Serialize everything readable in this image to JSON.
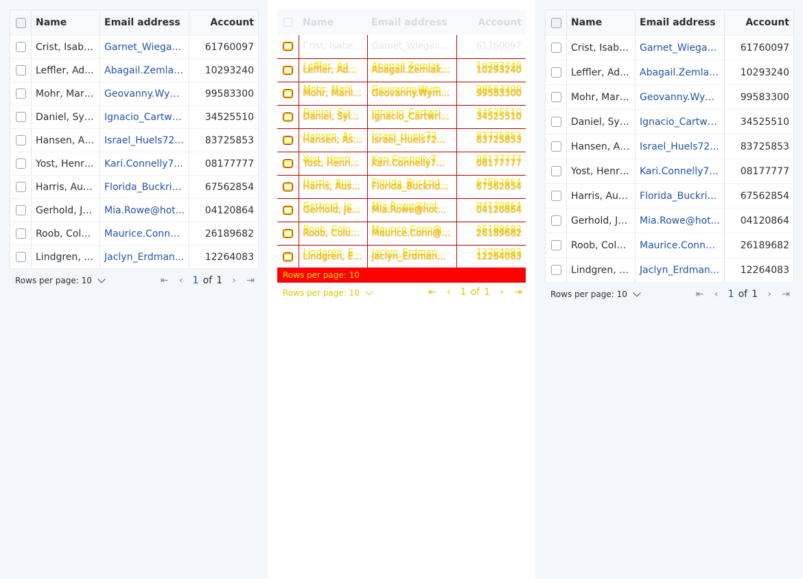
{
  "grid": {
    "columns": [
      "Name",
      "Email address",
      "Account"
    ],
    "rows": [
      {
        "name": "Crist, Isabe...",
        "email": "Garnet_Wiegan...",
        "account": "61760097"
      },
      {
        "name": "Leffler, Ad...",
        "email": "Abagail.Zemlak...",
        "account": "10293240"
      },
      {
        "name": "Mohr, Maril...",
        "email": "Geovanny.Wym...",
        "account": "99583300"
      },
      {
        "name": "Daniel, Syl...",
        "email": "Ignacio_Cartwri...",
        "account": "34525510"
      },
      {
        "name": "Hansen, As...",
        "email": "Israel_Huels72...",
        "account": "83725853"
      },
      {
        "name": "Yost, Henri...",
        "email": "Kari.Connelly7...",
        "account": "08177777"
      },
      {
        "name": "Harris, Aus...",
        "email": "Florida_Buckrid...",
        "account": "67562854"
      },
      {
        "name": "Gerhold, Je...",
        "email": "Mia.Rowe@hot...",
        "account": "04120864"
      },
      {
        "name": "Roob, Colu...",
        "email": "Maurice.Conn@...",
        "account": "26189682"
      },
      {
        "name": "Lindgren, E...",
        "email": "Jaclyn_Erdman...",
        "account": "12264083"
      }
    ]
  },
  "pagination": {
    "rows_per_page_label": "Rows per page: 10",
    "current_page": "1",
    "of_label": "of",
    "total_pages": "1"
  },
  "icons": {
    "first_page": "first-page-icon",
    "prev_page": "prev-page-icon",
    "next_page": "next-page-icon",
    "last_page": "last-page-icon",
    "dropdown": "chevron-down-icon"
  },
  "colors": {
    "link": "#2151a8",
    "corrupt_yellow": "#f2e400",
    "corrupt_red": "#ff0000"
  }
}
